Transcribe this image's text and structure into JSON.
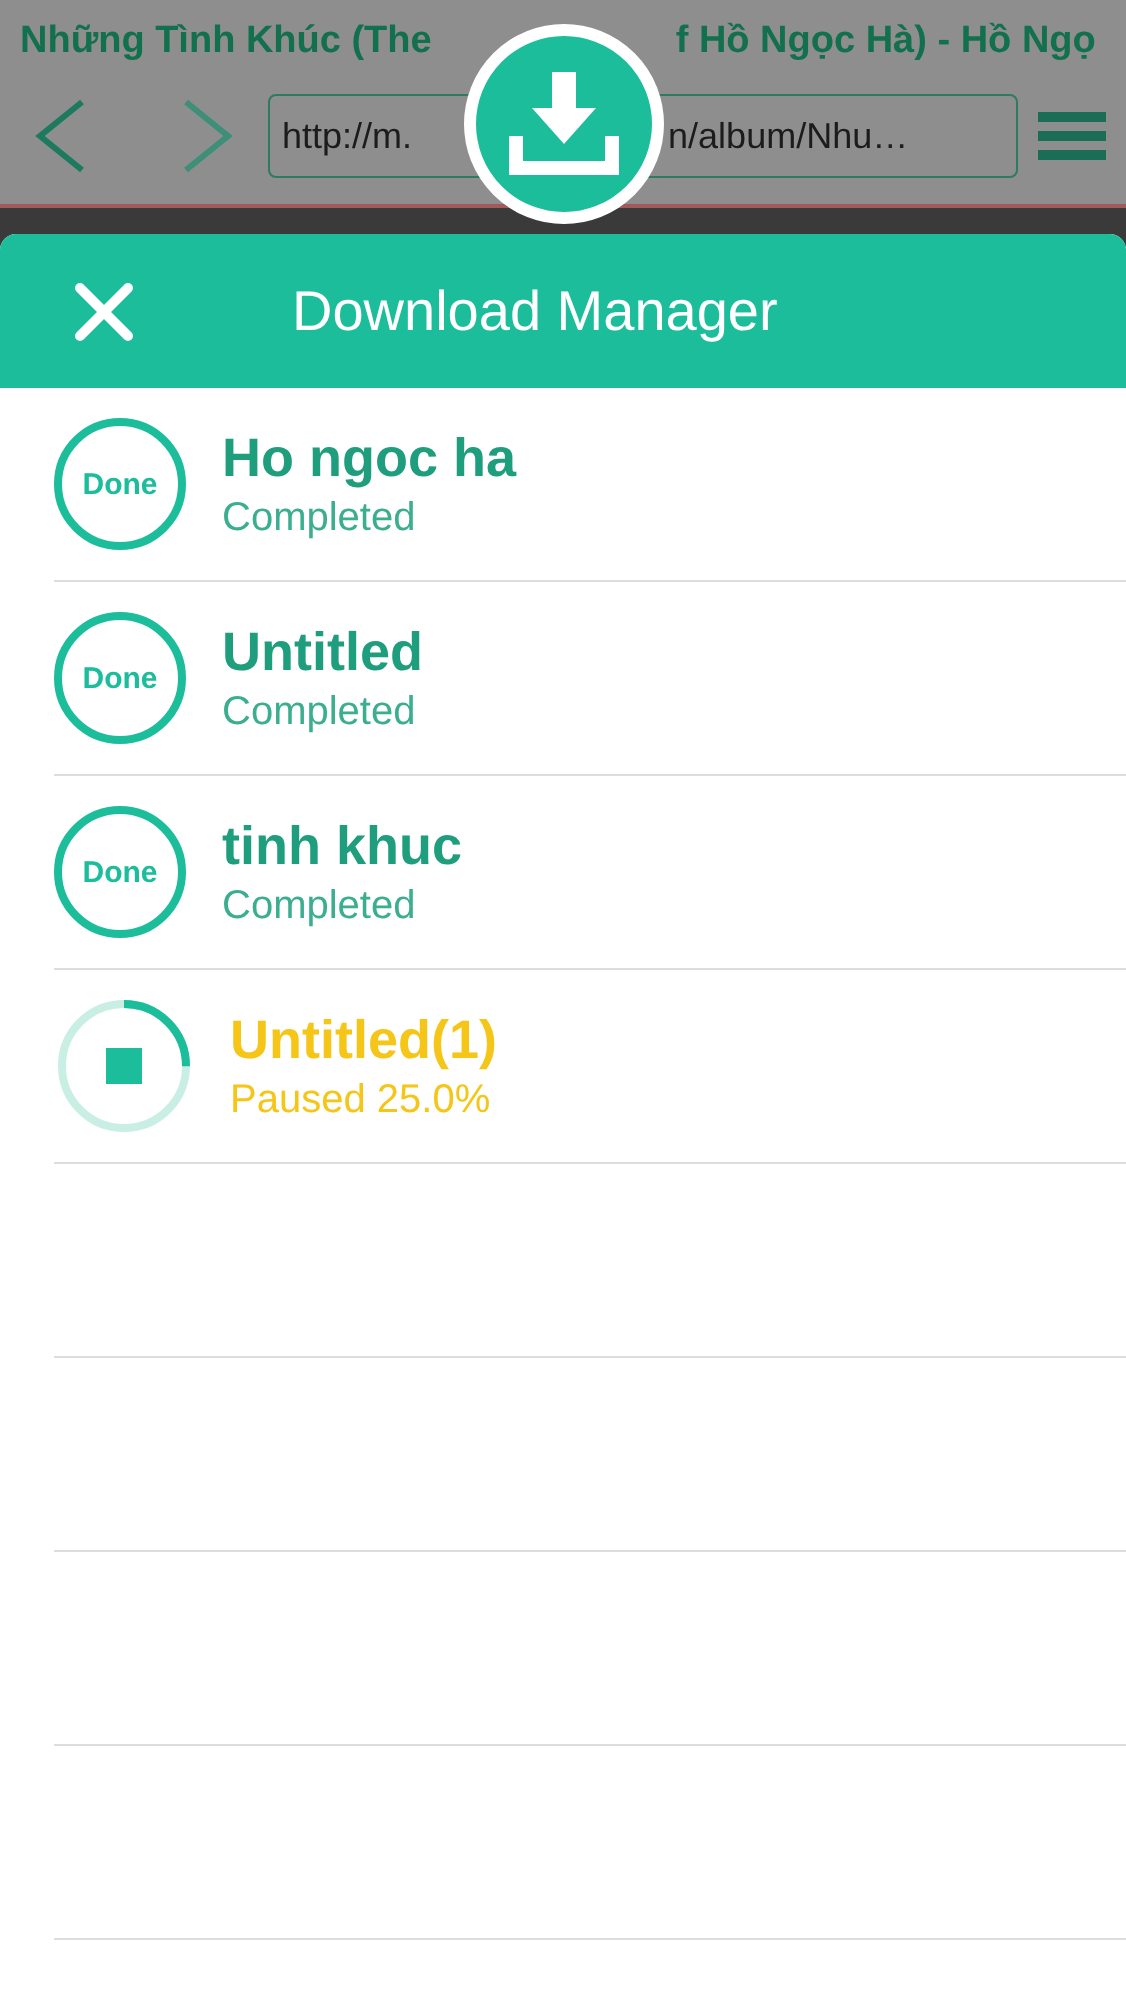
{
  "browser": {
    "title_parts": [
      "Những Tình Khúc (The",
      "f Hồ Ngọc Hà) - Hồ Ngọ"
    ],
    "url_parts": [
      "http://m.",
      "n/album/Nhu…"
    ]
  },
  "sheet": {
    "title": "Download Manager"
  },
  "downloads": [
    {
      "name": "Ho ngoc ha",
      "status": "Completed",
      "kind": "done",
      "badge": "Done"
    },
    {
      "name": "Untitled",
      "status": "Completed",
      "kind": "done",
      "badge": "Done"
    },
    {
      "name": "tinh khuc",
      "status": "Completed",
      "kind": "done",
      "badge": "Done"
    },
    {
      "name": "Untitled(1)",
      "status": "Paused 25.0%",
      "kind": "paused",
      "level": 0.25
    }
  ]
}
